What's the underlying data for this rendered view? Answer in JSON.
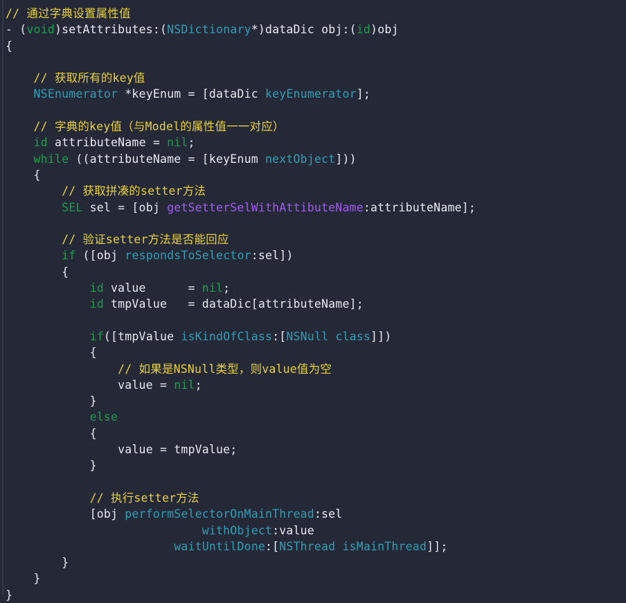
{
  "editor": {
    "language": "Objective-C",
    "background_color": "#242837",
    "foreground_color": "#e8eaf0",
    "colors": {
      "comment": "#e8d13d",
      "keyword": "#1a9e4b",
      "type": "#1a9e4b",
      "class_name": "#2e9fb5",
      "method_teal": "#2e9fb5",
      "selector_purple": "#a05cf0",
      "plain_text": "#e8eaf0",
      "gutter_rule": "#31374a"
    }
  },
  "code": {
    "lines": [
      {
        "indent": 0,
        "tokens": [
          {
            "t": "comment",
            "v": "// 通过字典设置属性值"
          }
        ]
      },
      {
        "indent": 0,
        "tokens": [
          {
            "t": "plain",
            "v": "- "
          },
          {
            "t": "punct",
            "v": "("
          },
          {
            "t": "keyword",
            "v": "void"
          },
          {
            "t": "punct",
            "v": ")"
          },
          {
            "t": "plain",
            "v": "setAttributes:"
          },
          {
            "t": "punct",
            "v": "("
          },
          {
            "t": "class",
            "v": "NSDictionary"
          },
          {
            "t": "plain",
            "v": "*"
          },
          {
            "t": "punct",
            "v": ")"
          },
          {
            "t": "plain",
            "v": "dataDic obj:"
          },
          {
            "t": "punct",
            "v": "("
          },
          {
            "t": "keyword",
            "v": "id"
          },
          {
            "t": "punct",
            "v": ")"
          },
          {
            "t": "plain",
            "v": "obj"
          }
        ]
      },
      {
        "indent": 0,
        "tokens": [
          {
            "t": "plain",
            "v": "{"
          }
        ]
      },
      {
        "indent": 0,
        "tokens": [
          {
            "t": "plain",
            "v": ""
          }
        ]
      },
      {
        "indent": 1,
        "tokens": [
          {
            "t": "comment",
            "v": "// 获取所有的key值"
          }
        ]
      },
      {
        "indent": 1,
        "tokens": [
          {
            "t": "class",
            "v": "NSEnumerator"
          },
          {
            "t": "plain",
            "v": " *keyEnum = [dataDic "
          },
          {
            "t": "method",
            "v": "keyEnumerator"
          },
          {
            "t": "plain",
            "v": "];"
          }
        ]
      },
      {
        "indent": 0,
        "tokens": [
          {
            "t": "plain",
            "v": ""
          }
        ]
      },
      {
        "indent": 1,
        "tokens": [
          {
            "t": "comment",
            "v": "// 字典的key值（与Model的属性值一一对应）"
          }
        ]
      },
      {
        "indent": 1,
        "tokens": [
          {
            "t": "keyword",
            "v": "id"
          },
          {
            "t": "plain",
            "v": " attributeName = "
          },
          {
            "t": "keyword",
            "v": "nil"
          },
          {
            "t": "plain",
            "v": ";"
          }
        ]
      },
      {
        "indent": 1,
        "tokens": [
          {
            "t": "keyword",
            "v": "while"
          },
          {
            "t": "plain",
            "v": " ((attributeName = [keyEnum "
          },
          {
            "t": "method",
            "v": "nextObject"
          },
          {
            "t": "plain",
            "v": "]))"
          }
        ]
      },
      {
        "indent": 1,
        "tokens": [
          {
            "t": "plain",
            "v": "{"
          }
        ]
      },
      {
        "indent": 2,
        "tokens": [
          {
            "t": "comment",
            "v": "// 获取拼凑的setter方法"
          }
        ]
      },
      {
        "indent": 2,
        "tokens": [
          {
            "t": "keyword",
            "v": "SEL"
          },
          {
            "t": "plain",
            "v": " sel = [obj "
          },
          {
            "t": "selector",
            "v": "getSetterSelWithAttibuteName"
          },
          {
            "t": "plain",
            "v": ":attributeName];"
          }
        ]
      },
      {
        "indent": 0,
        "tokens": [
          {
            "t": "plain",
            "v": ""
          }
        ]
      },
      {
        "indent": 2,
        "tokens": [
          {
            "t": "comment",
            "v": "// 验证setter方法是否能回应"
          }
        ]
      },
      {
        "indent": 2,
        "tokens": [
          {
            "t": "keyword",
            "v": "if"
          },
          {
            "t": "plain",
            "v": " ([obj "
          },
          {
            "t": "method",
            "v": "respondsToSelector"
          },
          {
            "t": "plain",
            "v": ":sel])"
          }
        ]
      },
      {
        "indent": 2,
        "tokens": [
          {
            "t": "plain",
            "v": "{"
          }
        ]
      },
      {
        "indent": 3,
        "tokens": [
          {
            "t": "keyword",
            "v": "id"
          },
          {
            "t": "plain",
            "v": " value      = "
          },
          {
            "t": "keyword",
            "v": "nil"
          },
          {
            "t": "plain",
            "v": ";"
          }
        ]
      },
      {
        "indent": 3,
        "tokens": [
          {
            "t": "keyword",
            "v": "id"
          },
          {
            "t": "plain",
            "v": " tmpValue   = dataDic[attributeName];"
          }
        ]
      },
      {
        "indent": 0,
        "tokens": [
          {
            "t": "plain",
            "v": ""
          }
        ]
      },
      {
        "indent": 3,
        "tokens": [
          {
            "t": "keyword",
            "v": "if"
          },
          {
            "t": "plain",
            "v": "([tmpValue "
          },
          {
            "t": "method",
            "v": "isKindOfClass"
          },
          {
            "t": "plain",
            "v": ":["
          },
          {
            "t": "class",
            "v": "NSNull"
          },
          {
            "t": "plain",
            "v": " "
          },
          {
            "t": "method",
            "v": "class"
          },
          {
            "t": "plain",
            "v": "]])"
          }
        ]
      },
      {
        "indent": 3,
        "tokens": [
          {
            "t": "plain",
            "v": "{"
          }
        ]
      },
      {
        "indent": 4,
        "tokens": [
          {
            "t": "comment",
            "v": "// 如果是NSNull类型，则value值为空"
          }
        ]
      },
      {
        "indent": 3,
        "tokens": [
          {
            "t": "plain",
            "v": "    value = "
          },
          {
            "t": "keyword",
            "v": "nil"
          },
          {
            "t": "plain",
            "v": ";"
          }
        ]
      },
      {
        "indent": 3,
        "tokens": [
          {
            "t": "plain",
            "v": "}"
          }
        ]
      },
      {
        "indent": 3,
        "tokens": [
          {
            "t": "keyword",
            "v": "else"
          }
        ]
      },
      {
        "indent": 3,
        "tokens": [
          {
            "t": "plain",
            "v": "{"
          }
        ]
      },
      {
        "indent": 4,
        "tokens": [
          {
            "t": "plain",
            "v": "value = tmpValue;"
          }
        ]
      },
      {
        "indent": 3,
        "tokens": [
          {
            "t": "plain",
            "v": "}"
          }
        ]
      },
      {
        "indent": 0,
        "tokens": [
          {
            "t": "plain",
            "v": ""
          }
        ]
      },
      {
        "indent": 3,
        "tokens": [
          {
            "t": "comment",
            "v": "// 执行setter方法"
          }
        ]
      },
      {
        "indent": 3,
        "tokens": [
          {
            "t": "plain",
            "v": "[obj "
          },
          {
            "t": "method",
            "v": "performSelectorOnMainThread"
          },
          {
            "t": "plain",
            "v": ":sel"
          }
        ]
      },
      {
        "indent": 3,
        "tokens": [
          {
            "t": "plain",
            "v": "                "
          },
          {
            "t": "method",
            "v": "withObject"
          },
          {
            "t": "plain",
            "v": ":value"
          }
        ]
      },
      {
        "indent": 3,
        "tokens": [
          {
            "t": "plain",
            "v": "            "
          },
          {
            "t": "method",
            "v": "waitUntilDone"
          },
          {
            "t": "plain",
            "v": ":["
          },
          {
            "t": "class",
            "v": "NSThread"
          },
          {
            "t": "plain",
            "v": " "
          },
          {
            "t": "method",
            "v": "isMainThread"
          },
          {
            "t": "plain",
            "v": "]];"
          }
        ]
      },
      {
        "indent": 2,
        "tokens": [
          {
            "t": "plain",
            "v": "}"
          }
        ]
      },
      {
        "indent": 1,
        "tokens": [
          {
            "t": "plain",
            "v": "}"
          }
        ]
      },
      {
        "indent": 0,
        "tokens": [
          {
            "t": "plain",
            "v": "}"
          }
        ]
      }
    ]
  }
}
